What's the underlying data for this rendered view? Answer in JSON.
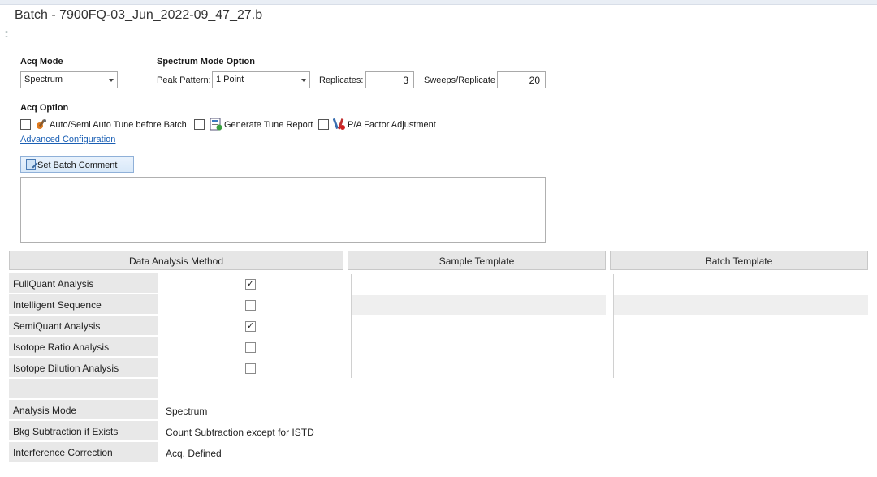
{
  "window": {
    "title": "Batch - 7900FQ-03_Jun_2022-09_47_27.b"
  },
  "acq_mode": {
    "label": "Acq Mode",
    "value": "Spectrum"
  },
  "spectrum_mode": {
    "label": "Spectrum Mode Option",
    "peak_pattern_label": "Peak Pattern:",
    "peak_pattern_value": "1 Point",
    "replicates_label": "Replicates:",
    "replicates_value": "3",
    "sweeps_label": "Sweeps/Replicate",
    "sweeps_value": "20"
  },
  "acq_option": {
    "label": "Acq Option",
    "auto_tune_label": "Auto/Semi Auto Tune before Batch",
    "generate_tune_label": "Generate Tune Report",
    "pa_factor_label": "P/A Factor Adjustment",
    "auto_tune_checked": false,
    "generate_tune_checked": false,
    "pa_factor_checked": false
  },
  "advanced_link": "Advanced Configuration",
  "set_batch_comment_button": "Set Batch Comment",
  "comment_text": "",
  "table": {
    "headers": {
      "data_analysis_method": "Data Analysis Method",
      "sample_template": "Sample Template",
      "batch_template": "Batch Template"
    },
    "analysis_rows": [
      {
        "label": "FullQuant Analysis",
        "checked": true
      },
      {
        "label": "Intelligent Sequence",
        "checked": false
      },
      {
        "label": "SemiQuant Analysis",
        "checked": true
      },
      {
        "label": "Isotope Ratio Analysis",
        "checked": false
      },
      {
        "label": "Isotope Dilution Analysis",
        "checked": false
      }
    ],
    "info_rows": [
      {
        "label": "Analysis Mode",
        "value": "Spectrum"
      },
      {
        "label": "Bkg Subtraction if Exists",
        "value": "Count Subtraction except for ISTD"
      },
      {
        "label": "Interference Correction",
        "value": "Acq. Defined"
      }
    ]
  },
  "colors": {
    "link": "#1a5fb4",
    "header_bg": "#e6e6e6",
    "row_label_bg": "#e8e8e8"
  }
}
